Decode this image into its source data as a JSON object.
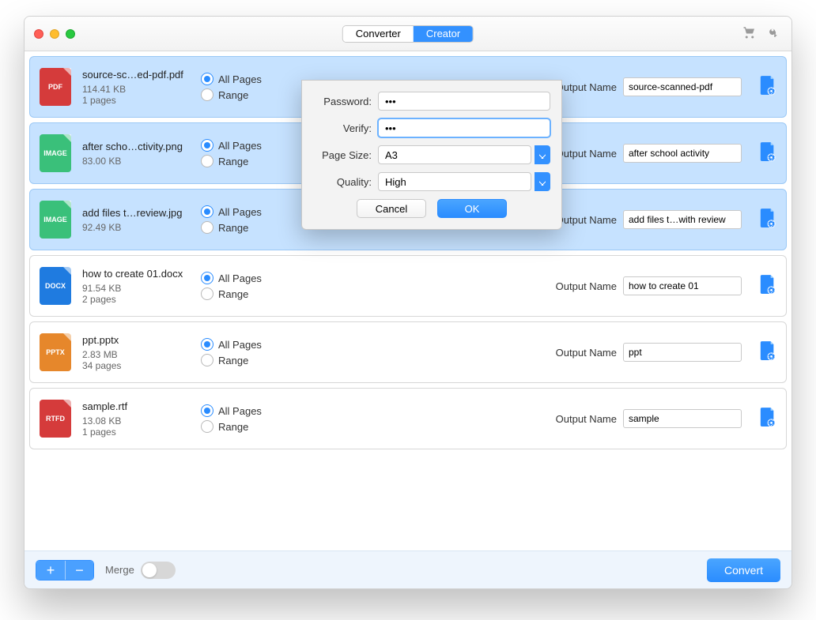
{
  "titlebar": {
    "tabs": {
      "converter": "Converter",
      "creator": "Creator",
      "active": "creator"
    }
  },
  "dialog": {
    "password_label": "Password:",
    "password_value": "•••",
    "verify_label": "Verify:",
    "verify_value": "•••",
    "pagesize_label": "Page Size:",
    "pagesize_value": "A3",
    "quality_label": "Quality:",
    "quality_value": "High",
    "cancel": "Cancel",
    "ok": "OK"
  },
  "columns": {
    "all_pages": "All Pages",
    "range": "Range",
    "output_name": "Output Name"
  },
  "files": [
    {
      "type": "PDF",
      "cls": "fi-pdf",
      "name": "source-sc…ed-pdf.pdf",
      "size": "114.41 KB",
      "pages": "1 pages",
      "output": "source-scanned-pdf",
      "selected": true
    },
    {
      "type": "IMAGE",
      "cls": "fi-img",
      "name": "after scho…ctivity.png",
      "size": "83.00 KB",
      "pages": "",
      "output": "after school activity",
      "selected": true
    },
    {
      "type": "IMAGE",
      "cls": "fi-img",
      "name": "add files t…review.jpg",
      "size": "92.49 KB",
      "pages": "",
      "output": "add files t…with review",
      "selected": true
    },
    {
      "type": "DOCX",
      "cls": "fi-docx",
      "name": "how to create 01.docx",
      "size": "91.54 KB",
      "pages": "2 pages",
      "output": "how to create 01",
      "selected": false
    },
    {
      "type": "PPTX",
      "cls": "fi-pptx",
      "name": "ppt.pptx",
      "size": "2.83 MB",
      "pages": "34 pages",
      "output": "ppt",
      "selected": false
    },
    {
      "type": "RTFD",
      "cls": "fi-rtfd",
      "name": "sample.rtf",
      "size": "13.08 KB",
      "pages": "1 pages",
      "output": "sample",
      "selected": false
    }
  ],
  "bottom": {
    "merge": "Merge",
    "convert": "Convert"
  }
}
